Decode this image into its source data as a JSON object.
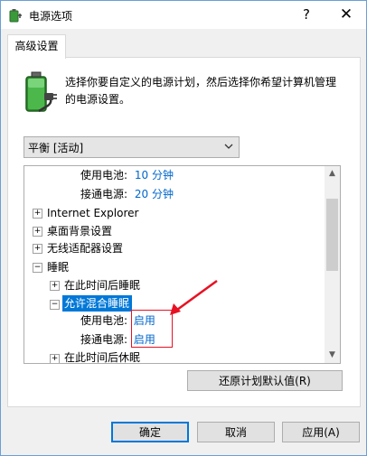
{
  "window": {
    "title": "电源选项",
    "help_glyph": "?",
    "close_glyph": "✕"
  },
  "tab": {
    "label": "高级设置"
  },
  "description": "选择你要自定义的电源计划，然后选择你希望计算机管理的电源设置。",
  "plan_select": {
    "value": "平衡 [活动]"
  },
  "tree": {
    "rows": [
      {
        "label": "使用电池:",
        "value": "10 分钟"
      },
      {
        "label": "接通电源:",
        "value": "20 分钟"
      },
      {
        "label": "Internet Explorer",
        "expander": "+"
      },
      {
        "label": "桌面背景设置",
        "expander": "+"
      },
      {
        "label": "无线适配器设置",
        "expander": "+"
      },
      {
        "label": "睡眠",
        "expander": "−"
      },
      {
        "label": "在此时间后睡眠",
        "expander": "+"
      },
      {
        "label": "允许混合睡眠",
        "expander": "−",
        "selected": true
      },
      {
        "label": "使用电池:",
        "value": "启用"
      },
      {
        "label": "接通电源:",
        "value": "启用"
      },
      {
        "label": "在此时间后休眠",
        "expander": "+"
      }
    ]
  },
  "buttons": {
    "restore": "还原计划默认值(R)",
    "ok": "确定",
    "cancel": "取消",
    "apply": "应用(A)"
  },
  "colors": {
    "accent": "#0078d7",
    "value_text": "#0066cc",
    "annotation": "#e81123"
  }
}
